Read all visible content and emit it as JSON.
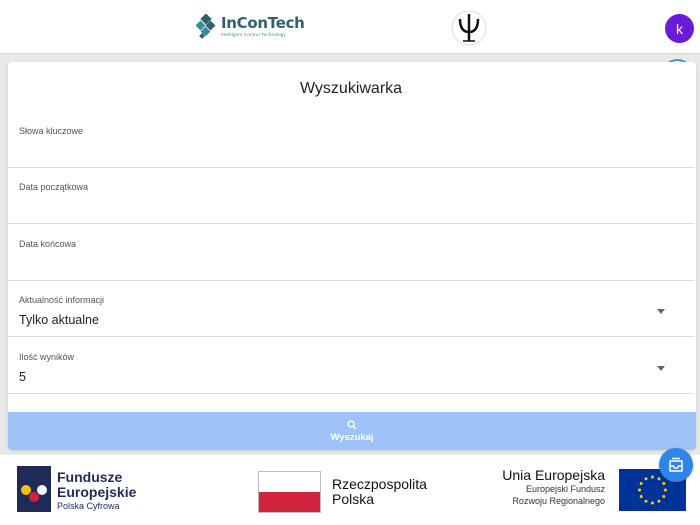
{
  "header": {
    "incon_brand": "InConTech",
    "incon_tagline": "Intelligent Control Technology",
    "user_initial": "k"
  },
  "form": {
    "title": "Wyszukiwarka",
    "fields": [
      {
        "label": "Słowa kluczowe",
        "value": ""
      },
      {
        "label": "Data początkowa",
        "value": ""
      },
      {
        "label": "Data końcowa",
        "value": ""
      },
      {
        "label": "Aktualność informacji",
        "value": "Tylko aktualne"
      },
      {
        "label": "Ilość wyników",
        "value": "5"
      }
    ],
    "search_label": "Wyszukaj"
  },
  "footer": {
    "fe_line1": "Fundusze",
    "fe_line2": "Europejskie",
    "fe_line3": "Polska Cyfrowa",
    "pl_line1": "Rzeczpospolita",
    "pl_line2": "Polska",
    "ue_line1": "Unia Europejska",
    "ue_line2": "Europejski Fundusz",
    "ue_line3": "Rozwoju Regionalnego"
  },
  "colors": {
    "avatar": "#6a1bd8",
    "search_button": "#9ec3f9",
    "fab": "#2e84e8"
  },
  "icons": [
    "incontech-logo",
    "psi-logo",
    "accessibility-icon",
    "search-icon",
    "inbox-icon",
    "dropdown-arrow-icon"
  ]
}
